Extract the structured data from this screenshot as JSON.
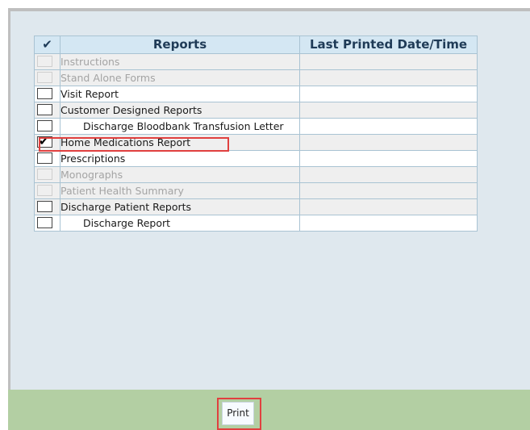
{
  "table": {
    "header": {
      "check_glyph": "✔",
      "reports": "Reports",
      "last_printed": "Last Printed Date/Time"
    },
    "rows": [
      {
        "label": "Instructions",
        "checked": false,
        "disabled": true,
        "indent": false,
        "last_printed": ""
      },
      {
        "label": "Stand Alone Forms",
        "checked": false,
        "disabled": true,
        "indent": false,
        "last_printed": ""
      },
      {
        "label": "Visit Report",
        "checked": false,
        "disabled": false,
        "indent": false,
        "last_printed": ""
      },
      {
        "label": "Customer Designed Reports",
        "checked": false,
        "disabled": false,
        "indent": false,
        "last_printed": ""
      },
      {
        "label": "Discharge Bloodbank Transfusion Letter",
        "checked": false,
        "disabled": false,
        "indent": true,
        "last_printed": ""
      },
      {
        "label": "Home Medications Report",
        "checked": true,
        "disabled": false,
        "indent": false,
        "last_printed": ""
      },
      {
        "label": "Prescriptions",
        "checked": false,
        "disabled": false,
        "indent": false,
        "last_printed": ""
      },
      {
        "label": "Monographs",
        "checked": false,
        "disabled": true,
        "indent": false,
        "last_printed": ""
      },
      {
        "label": "Patient Health Summary",
        "checked": false,
        "disabled": true,
        "indent": false,
        "last_printed": ""
      },
      {
        "label": "Discharge Patient Reports",
        "checked": false,
        "disabled": false,
        "indent": false,
        "last_printed": ""
      },
      {
        "label": "Discharge Report",
        "checked": false,
        "disabled": false,
        "indent": true,
        "last_printed": ""
      }
    ]
  },
  "footer": {
    "print_label": "Print"
  },
  "colors": {
    "panel_background": "#dfe8ee",
    "header_background": "#d4e7f3",
    "footer_background": "#b3cfa3",
    "highlight": "#e0403f",
    "disabled_text": "#a4a4a4"
  }
}
